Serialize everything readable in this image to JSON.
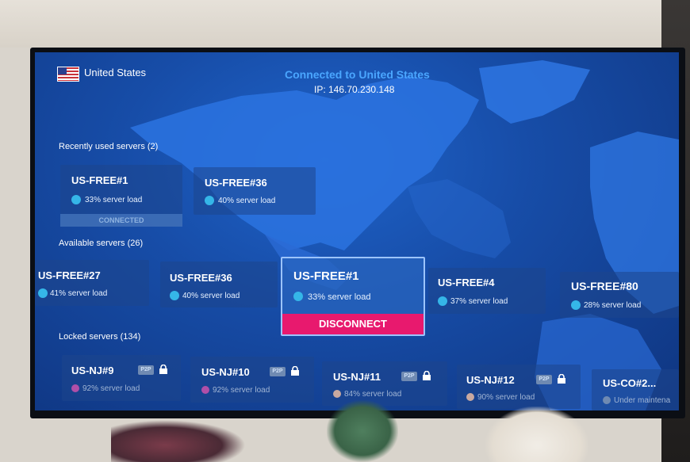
{
  "header": {
    "country": "United States",
    "status": "Connected to United States",
    "ip": "IP: 146.70.230.148"
  },
  "recent": {
    "title": "Recently used servers (2)",
    "servers": [
      {
        "name": "US-FREE#1",
        "load": "33% server load",
        "badge": "CONNECTED"
      },
      {
        "name": "US-FREE#36",
        "load": "40% server load"
      }
    ]
  },
  "available": {
    "title": "Available servers (26)",
    "servers": [
      {
        "name": "US-FREE#27",
        "load": "41% server load"
      },
      {
        "name": "US-FREE#36",
        "load": "40% server load"
      },
      {
        "name": "US-FREE#1",
        "load": "33% server load",
        "action": "DISCONNECT"
      },
      {
        "name": "US-FREE#4",
        "load": "37% server load"
      },
      {
        "name": "US-FREE#80",
        "load": "28% server load"
      }
    ]
  },
  "locked": {
    "title": "Locked servers (134)",
    "p2p_label": "P2P",
    "servers": [
      {
        "name": "US-NJ#9",
        "load": "92% server load"
      },
      {
        "name": "US-NJ#10",
        "load": "92% server load"
      },
      {
        "name": "US-NJ#11",
        "load": "84% server load"
      },
      {
        "name": "US-NJ#12",
        "load": "90% server load"
      },
      {
        "name": "US-CO#2...",
        "load": "Under maintena"
      }
    ]
  },
  "colors": {
    "accent_disconnect": "#e8196e",
    "load_dot": "#35b6e8",
    "locked_dot_high": "#b04fa8",
    "locked_dot_mid": "#c9a9a0"
  }
}
